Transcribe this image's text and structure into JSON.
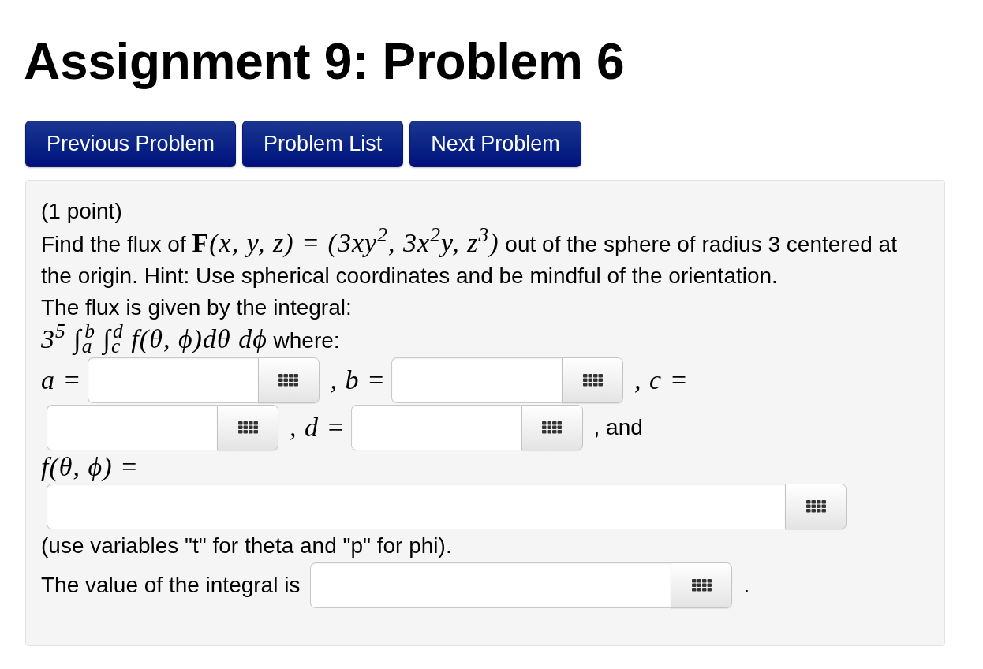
{
  "title": "Assignment 9: Problem 6",
  "nav_buttons": [
    "Previous Problem",
    "Problem List",
    "Next Problem"
  ],
  "problem": {
    "points": "(1 point)",
    "blocks": [
      {
        "kind": "paragraph",
        "segments": [
          {
            "kind": "text",
            "text": "Find the flux of "
          },
          {
            "kind": "math",
            "text": "**F**(x, y, z) = (3xy$^{2}$, 3x$^{2}$y, z$^{3}$)"
          },
          {
            "kind": "text",
            "text": " out of the sphere of radius 3 centered at the origin. Hint: Use spherical coordinates and be mindful of the orientation."
          }
        ]
      },
      {
        "kind": "paragraph",
        "segments": [
          {
            "kind": "text",
            "text": "The flux is given by the integral:"
          }
        ]
      },
      {
        "kind": "paragraph",
        "segments": [
          {
            "kind": "math",
            "text": "3$^{5}$ ∫$_{a}$$^{b}$ ∫$_{c}$$^{d}$ f(θ, ϕ)dθ dϕ"
          },
          {
            "kind": "text",
            "text": " where:"
          }
        ]
      },
      {
        "kind": "answer_line",
        "items": [
          {
            "kind": "math",
            "text": "a ="
          },
          {
            "kind": "field"
          },
          {
            "kind": "math",
            "text": ", b ="
          },
          {
            "kind": "field"
          },
          {
            "kind": "math",
            "text": ", c ="
          }
        ]
      },
      {
        "kind": "answer_line",
        "items": [
          {
            "kind": "field"
          },
          {
            "kind": "math",
            "text": ", d ="
          },
          {
            "kind": "field"
          },
          {
            "kind": "text",
            "text": ", and"
          }
        ]
      },
      {
        "kind": "answer_line",
        "items": [
          {
            "kind": "math",
            "text": "f(θ, ϕ) ="
          }
        ]
      },
      {
        "kind": "answer_line",
        "items": [
          {
            "kind": "field"
          }
        ]
      },
      {
        "kind": "answer_line",
        "items": [
          {
            "kind": "text",
            "text": "(use variables \"t\" for theta and \"p\" for phi)."
          }
        ]
      },
      {
        "kind": "answer_line",
        "items": [
          {
            "kind": "text",
            "text": "The value of the integral is"
          },
          {
            "kind": "field"
          },
          {
            "kind": "text",
            "text": "."
          }
        ]
      }
    ]
  }
}
